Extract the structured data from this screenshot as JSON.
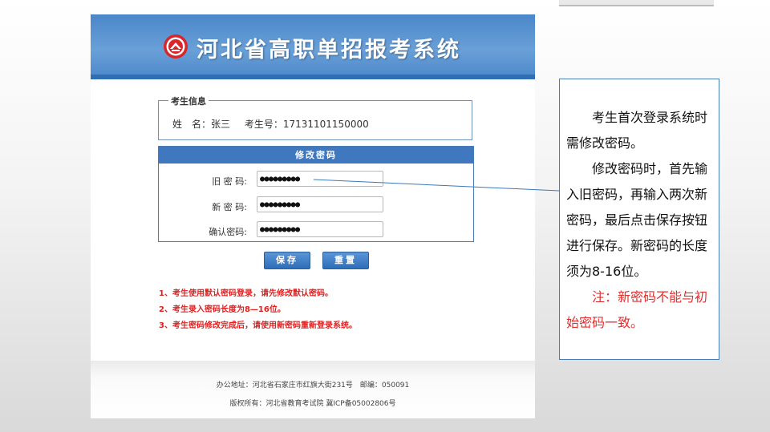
{
  "header": {
    "title": "河北省高职单招报考系统"
  },
  "info": {
    "legend": "考生信息",
    "name_label": "姓　名：张三",
    "id_label": "考生号：17131101150000"
  },
  "password": {
    "title": "修改密码",
    "old_label": "旧 密 码:",
    "old_value": "●●●●●●●●●",
    "new_label": "新 密 码:",
    "new_value": "●●●●●●●●●",
    "confirm_label": "确认密码:",
    "confirm_value": "●●●●●●●●●"
  },
  "buttons": {
    "save": "保存",
    "reset": "重置"
  },
  "notes": [
    "1、考生使用默认密码登录，请先修改默认密码。",
    "2、考生录入密码长度为8—16位。",
    "3、考生密码修改完成后，请使用新密码重新登录系统。"
  ],
  "footer": {
    "address": "办公地址：河北省石家庄市红旗大街231号　邮编：050091",
    "copyright": "版权所有：河北省教育考试院 冀ICP备05002806号"
  },
  "callout": {
    "p1": "考生首次登录系统时需修改密码。",
    "p2": "修改密码时，首先输入旧密码，再输入两次新密码，最后点击保存按钮进行保存。新密码的长度须为8-16位。",
    "p3": "注：新密码不能与初始密码一致。"
  },
  "colors": {
    "banner": "#4a86c8",
    "header_bar": "#3f78bf",
    "note_red": "#e02020"
  }
}
